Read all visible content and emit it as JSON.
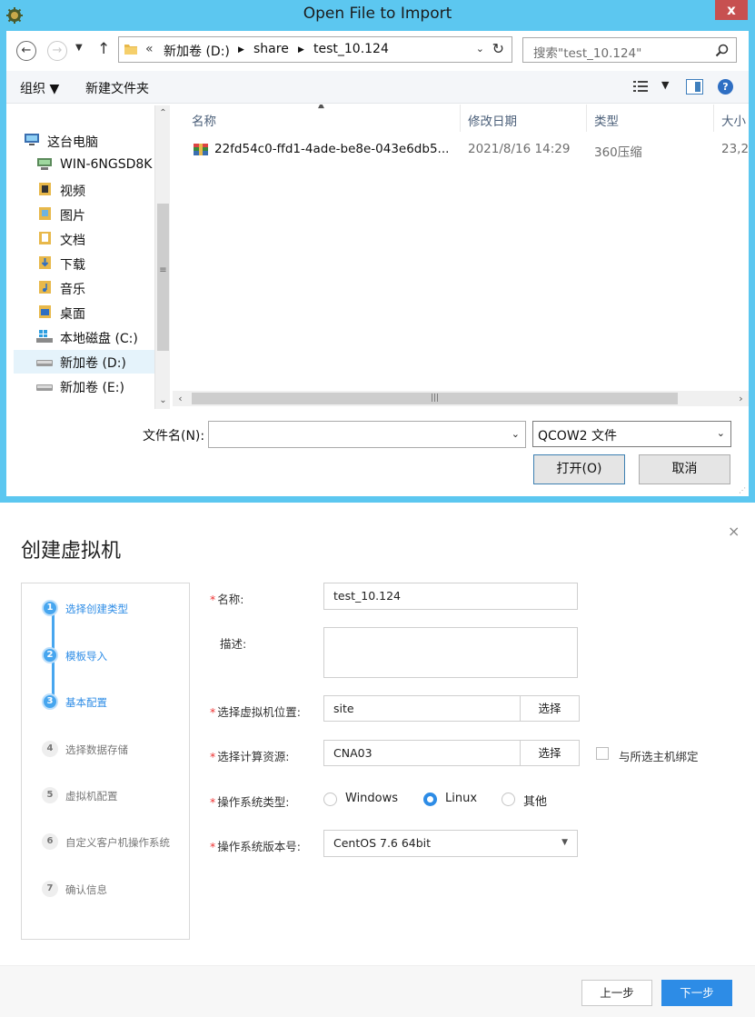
{
  "dialog": {
    "title": "Open File to Import",
    "close_label": "x",
    "address": {
      "overflow": "«",
      "crumbs": [
        "新加卷 (D:)",
        "share",
        "test_10.124"
      ]
    },
    "search_placeholder": "搜索\"test_10.124\"",
    "toolbar": {
      "organize": "组织 ▼",
      "new_folder": "新建文件夹"
    },
    "nav": [
      {
        "label": "这台电脑",
        "icon": "computer-icon"
      },
      {
        "label": "WIN-6NGSD8K",
        "icon": "network-computer-icon"
      },
      {
        "label": "视频",
        "icon": "videos-folder-icon"
      },
      {
        "label": "图片",
        "icon": "pictures-folder-icon"
      },
      {
        "label": "文档",
        "icon": "documents-folder-icon"
      },
      {
        "label": "下载",
        "icon": "downloads-folder-icon"
      },
      {
        "label": "音乐",
        "icon": "music-folder-icon"
      },
      {
        "label": "桌面",
        "icon": "desktop-folder-icon"
      },
      {
        "label": "本地磁盘 (C:)",
        "icon": "system-drive-icon"
      },
      {
        "label": "新加卷 (D:)",
        "icon": "drive-icon",
        "selected": true
      },
      {
        "label": "新加卷 (E:)",
        "icon": "drive-icon"
      }
    ],
    "columns": [
      "名称",
      "修改日期",
      "类型",
      "大小"
    ],
    "files": [
      {
        "name": "22fd54c0-ffd1-4ade-be8e-043e6db5...",
        "modified": "2021/8/16 14:29",
        "type": "360压缩",
        "size": "23,2"
      }
    ],
    "filename_label": "文件名(N):",
    "filename_value": "",
    "filter": "QCOW2 文件",
    "open_label": "打开(O)",
    "cancel_label": "取消",
    "colors": {
      "frame": "#5cc7f0",
      "close": "#c75050"
    }
  },
  "vm": {
    "title": "创建虚拟机",
    "close_label": "×",
    "steps": [
      {
        "num": "1",
        "label": "选择创建类型",
        "active": true
      },
      {
        "num": "2",
        "label": "模板导入",
        "active": true
      },
      {
        "num": "3",
        "label": "基本配置",
        "active": true
      },
      {
        "num": "4",
        "label": "选择数据存储",
        "active": false
      },
      {
        "num": "5",
        "label": "虚拟机配置",
        "active": false
      },
      {
        "num": "6",
        "label": "自定义客户机操作系统",
        "active": false
      },
      {
        "num": "7",
        "label": "确认信息",
        "active": false
      }
    ],
    "form": {
      "name_label": "名称:",
      "name_value": "test_10.124",
      "desc_label": "描述:",
      "desc_value": "",
      "location_label": "选择虚拟机位置:",
      "location_value": "site",
      "location_btn": "选择",
      "compute_label": "选择计算资源:",
      "compute_value": "CNA03",
      "compute_btn": "选择",
      "bind_host_label": "与所选主机绑定",
      "bind_host_checked": false,
      "os_type_label": "操作系统类型:",
      "os_options": [
        "Windows",
        "Linux",
        "其他"
      ],
      "os_selected": "Linux",
      "os_version_label": "操作系统版本号:",
      "os_version_value": "CentOS 7.6 64bit"
    },
    "prev_label": "上一步",
    "next_label": "下一步",
    "colors": {
      "accent": "#2d8ce6",
      "step_active": "#47a6ef",
      "required": "#e33333"
    }
  }
}
